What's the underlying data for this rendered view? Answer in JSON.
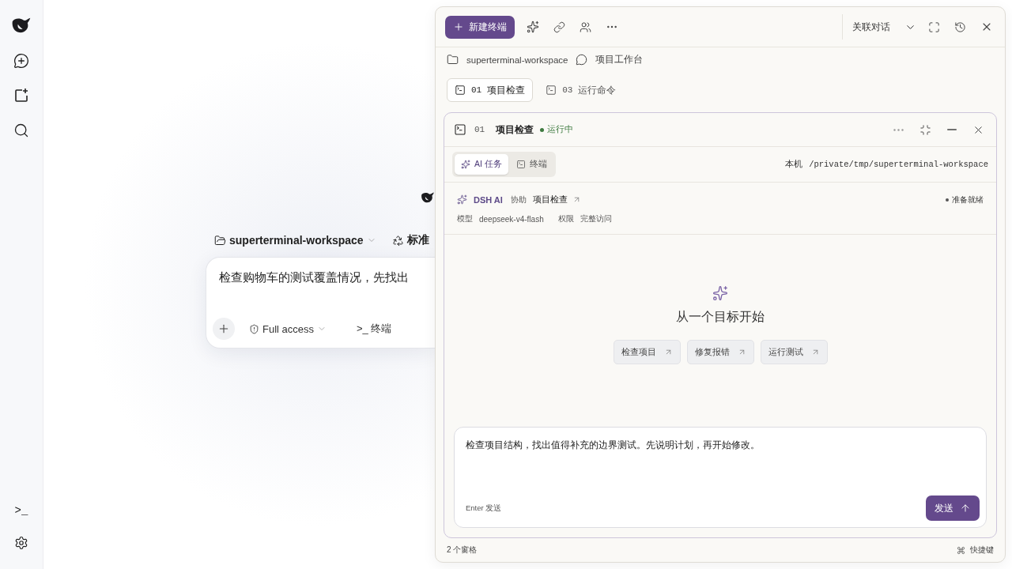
{
  "sidebar": {
    "terminal_glyph": ">_"
  },
  "main": {
    "folder": "superterminal-workspace",
    "mode": "标准",
    "prompt": "检查购物车的测试覆盖情况，先找出",
    "access": "Full access",
    "terminal": ">_ 终端"
  },
  "panel": {
    "new_terminal": "新建终端",
    "linked_dialog": "关联对话",
    "breadcrumb": {
      "folder": "superterminal-workspace",
      "workspace": "项目工作台"
    },
    "tabs": [
      {
        "number": "01",
        "label": "项目检查",
        "selected": true
      },
      {
        "number": "03",
        "label": "运行命令",
        "selected": false
      }
    ],
    "pane": {
      "number": "01",
      "title": "项目检查",
      "status": {
        "label": "运行中",
        "color": "#3d7a3f"
      },
      "mode_tabs": [
        {
          "kind": "ai",
          "label": "AI 任务",
          "selected": true
        },
        {
          "kind": "terminal",
          "label": "终端",
          "selected": false
        }
      ],
      "location": "本机",
      "path": "/private/tmp/superterminal-workspace",
      "agent": {
        "name": "DSH AI",
        "role": "协助",
        "task": "项目检查",
        "status": {
          "label": "准备就绪",
          "color": "#555555"
        },
        "model_label": "模型",
        "model": "deepseek-v4-flash",
        "permission_label": "权限",
        "permission": "完整访问"
      },
      "empty": {
        "title": "从一个目标开始",
        "suggestions": [
          "检查项目",
          "修复报错",
          "运行测试"
        ]
      },
      "composer": {
        "value": "检查项目结构，找出值得补充的边界测试。先说明计划，再开始修改。",
        "hint": "Enter 发送",
        "send": "发送"
      }
    },
    "footer": {
      "panes": "2 个窗格",
      "shortcuts": "快捷键"
    }
  }
}
